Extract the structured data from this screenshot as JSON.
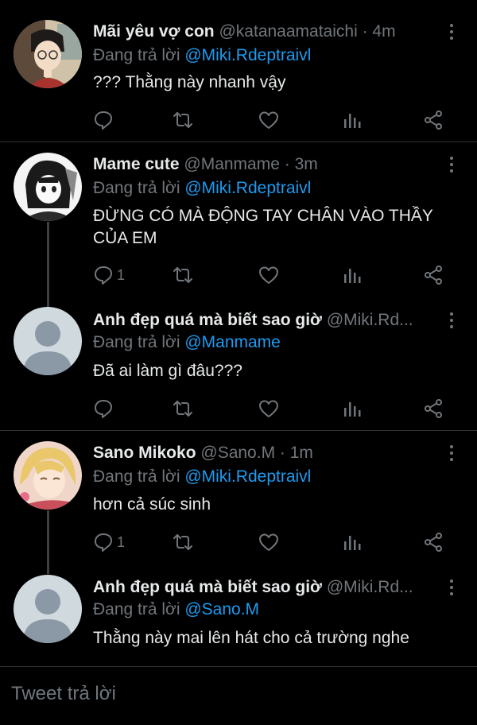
{
  "replying_prefix": "Đang trả lời",
  "tweets": [
    {
      "name": "Mãi yêu vợ con",
      "handle": "@katanaamataichi · 4m",
      "mention": "@Miki.Rdeptraivl",
      "text": "??? Thằng này nhanh vậy",
      "reply_count": "",
      "avatar": "anime-boy-glasses"
    },
    {
      "name": "Mame cute",
      "handle": "@Manmame · 3m",
      "mention": "@Miki.Rdeptraivl",
      "text": "ĐỪNG CÓ MÀ ĐỘNG TAY CHÂN VÀO THẦY CỦA EM",
      "reply_count": "1",
      "avatar": "manga-girl"
    },
    {
      "name": "Anh đẹp quá mà biết sao giờ",
      "handle": "@Miki.Rd...",
      "mention": "@Manmame",
      "text": "Đã ai làm gì đâu???",
      "reply_count": "",
      "avatar": "default-profile"
    },
    {
      "name": "Sano Mikoko",
      "handle": "@Sano.M · 1m",
      "mention": "@Miki.Rdeptraivl",
      "text": "hơn cả súc sinh",
      "reply_count": "1",
      "avatar": "anime-blonde"
    },
    {
      "name": "Anh đẹp quá mà biết sao giờ",
      "handle": "@Miki.Rd...",
      "mention": "@Sano.M",
      "text": "Thằng này mai lên hát cho cả trường nghe",
      "reply_count": "",
      "avatar": "default-profile"
    }
  ],
  "reply_placeholder": "Tweet trả lời",
  "colors": {
    "background": "#000000",
    "accent": "#1d9bf0",
    "muted": "#71767b",
    "text": "#e7e9ea"
  },
  "icons": [
    "reply-icon",
    "retweet-icon",
    "like-icon",
    "analytics-icon",
    "share-icon",
    "more-icon"
  ]
}
